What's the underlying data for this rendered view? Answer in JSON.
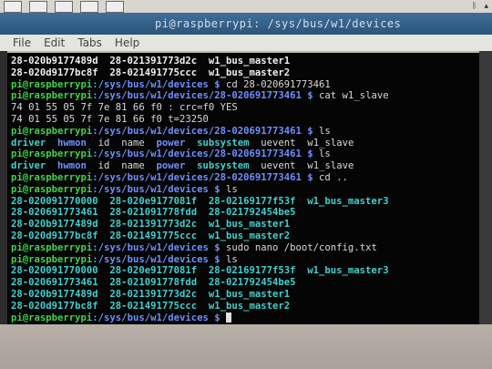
{
  "window": {
    "title": "pi@raspberrypi: /sys/bus/w1/devices"
  },
  "menu": {
    "items": [
      "File",
      "Edit",
      "Tabs",
      "Help"
    ]
  },
  "terminal": {
    "lines": [
      [
        {
          "t": "28-020b9177489d  28-021391773d2c  w1_bus_master1",
          "c": "bold"
        }
      ],
      [
        {
          "t": "28-020d9177bc8f  28-021491775ccc  w1_bus_master2",
          "c": "bold"
        }
      ],
      [
        {
          "t": "pi@raspberrypi",
          "c": "user"
        },
        {
          "t": ":/sys/bus/w1/devices $ ",
          "c": "path"
        },
        {
          "t": "cd 28-020691773461",
          "c": "plain"
        }
      ],
      [
        {
          "t": "pi@raspberrypi",
          "c": "user"
        },
        {
          "t": ":/sys/bus/w1/devices/28-020691773461 $ ",
          "c": "path"
        },
        {
          "t": "cat w1_slave",
          "c": "plain"
        }
      ],
      [
        {
          "t": "74 01 55 05 7f 7e 81 66 f0 : crc=f0 YES",
          "c": "plain"
        }
      ],
      [
        {
          "t": "74 01 55 05 7f 7e 81 66 f0 t=23250",
          "c": "plain"
        }
      ],
      [
        {
          "t": "pi@raspberrypi",
          "c": "user"
        },
        {
          "t": ":/sys/bus/w1/devices/28-020691773461 $ ",
          "c": "path"
        },
        {
          "t": "ls",
          "c": "plain"
        }
      ],
      [
        {
          "t": "driver  ",
          "c": "link"
        },
        {
          "t": "hwmon",
          "c": "dir"
        },
        {
          "t": "  id  name  ",
          "c": "plain"
        },
        {
          "t": "power",
          "c": "dir"
        },
        {
          "t": "  ",
          "c": "plain"
        },
        {
          "t": "subsystem",
          "c": "link"
        },
        {
          "t": "  uevent  w1_slave",
          "c": "plain"
        }
      ],
      [
        {
          "t": "pi@raspberrypi",
          "c": "user"
        },
        {
          "t": ":/sys/bus/w1/devices/28-020691773461 $ ",
          "c": "path"
        },
        {
          "t": "ls",
          "c": "plain"
        }
      ],
      [
        {
          "t": "driver  ",
          "c": "link"
        },
        {
          "t": "hwmon",
          "c": "dir"
        },
        {
          "t": "  id  name  ",
          "c": "plain"
        },
        {
          "t": "power",
          "c": "dir"
        },
        {
          "t": "  ",
          "c": "plain"
        },
        {
          "t": "subsystem",
          "c": "link"
        },
        {
          "t": "  uevent  w1_slave",
          "c": "plain"
        }
      ],
      [
        {
          "t": "pi@raspberrypi",
          "c": "user"
        },
        {
          "t": ":/sys/bus/w1/devices/28-020691773461 $ ",
          "c": "path"
        },
        {
          "t": "cd ..",
          "c": "plain"
        }
      ],
      [
        {
          "t": "pi@raspberrypi",
          "c": "user"
        },
        {
          "t": ":/sys/bus/w1/devices $ ",
          "c": "path"
        },
        {
          "t": "ls",
          "c": "plain"
        }
      ],
      [
        {
          "t": "28-020091770000  28-020e9177081f  28-02169177f53f  w1_bus_master3",
          "c": "link"
        }
      ],
      [
        {
          "t": "28-020691773461  28-021091778fdd  28-021792454be5",
          "c": "link"
        }
      ],
      [
        {
          "t": "28-020b9177489d  28-021391773d2c  w1_bus_master1",
          "c": "link"
        }
      ],
      [
        {
          "t": "28-020d9177bc8f  28-021491775ccc  w1_bus_master2",
          "c": "link"
        }
      ],
      [
        {
          "t": "pi@raspberrypi",
          "c": "user"
        },
        {
          "t": ":/sys/bus/w1/devices $ ",
          "c": "path"
        },
        {
          "t": "sudo nano /boot/config.txt",
          "c": "plain"
        }
      ],
      [
        {
          "t": "pi@raspberrypi",
          "c": "user"
        },
        {
          "t": ":/sys/bus/w1/devices $ ",
          "c": "path"
        },
        {
          "t": "ls",
          "c": "plain"
        }
      ],
      [
        {
          "t": "28-020091770000  28-020e9177081f  28-02169177f53f  w1_bus_master3",
          "c": "link"
        }
      ],
      [
        {
          "t": "28-020691773461  28-021091778fdd  28-021792454be5",
          "c": "link"
        }
      ],
      [
        {
          "t": "28-020b9177489d  28-021391773d2c  w1_bus_master1",
          "c": "link"
        }
      ],
      [
        {
          "t": "28-020d9177bc8f  28-021491775ccc  w1_bus_master2",
          "c": "link"
        }
      ],
      [
        {
          "t": "pi@raspberrypi",
          "c": "user"
        },
        {
          "t": ":/sys/bus/w1/devices $ ",
          "c": "path"
        }
      ]
    ]
  }
}
